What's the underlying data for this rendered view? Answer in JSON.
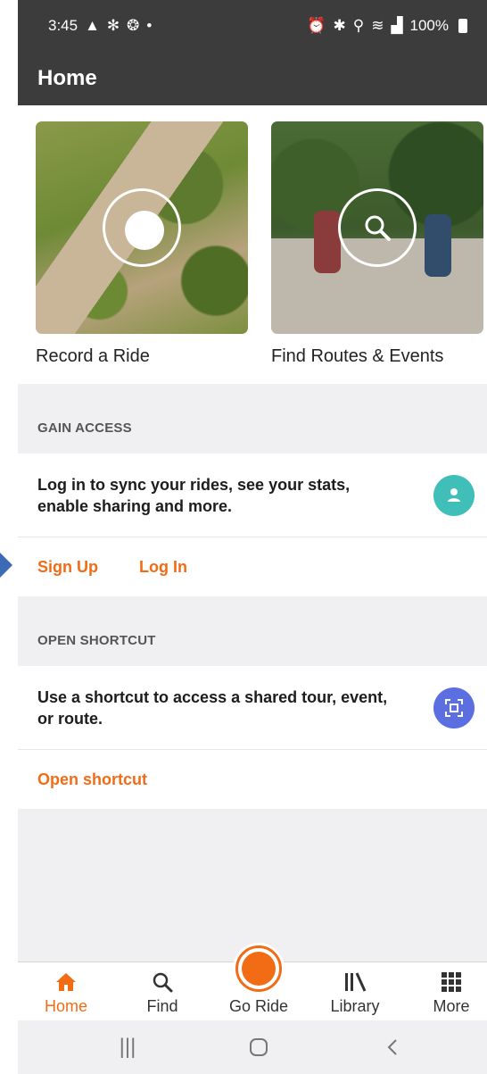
{
  "status_bar": {
    "time": "3:45",
    "battery": "100%"
  },
  "app_bar": {
    "title": "Home"
  },
  "hero": {
    "record": {
      "label": "Record a Ride"
    },
    "find": {
      "label": "Find Routes & Events"
    }
  },
  "gain_access": {
    "header": "GAIN ACCESS",
    "message": "Log in to sync your rides, see your stats, enable sharing and more.",
    "sign_up": "Sign Up",
    "log_in": "Log In"
  },
  "open_shortcut": {
    "header": "OPEN SHORTCUT",
    "message": "Use a shortcut to access a shared tour, event, or route.",
    "action": "Open shortcut"
  },
  "tabs": [
    {
      "label": "Home",
      "icon": "home-icon",
      "active": true
    },
    {
      "label": "Find",
      "icon": "search-icon",
      "active": false
    },
    {
      "label": "Go Ride",
      "icon": "record-icon",
      "active": false
    },
    {
      "label": "Library",
      "icon": "library-icon",
      "active": false
    },
    {
      "label": "More",
      "icon": "grid-icon",
      "active": false
    }
  ],
  "colors": {
    "accent": "#f26c16",
    "app_bar": "#3c3c3c",
    "teal": "#3fbfb8",
    "violet": "#5b6fe0"
  }
}
